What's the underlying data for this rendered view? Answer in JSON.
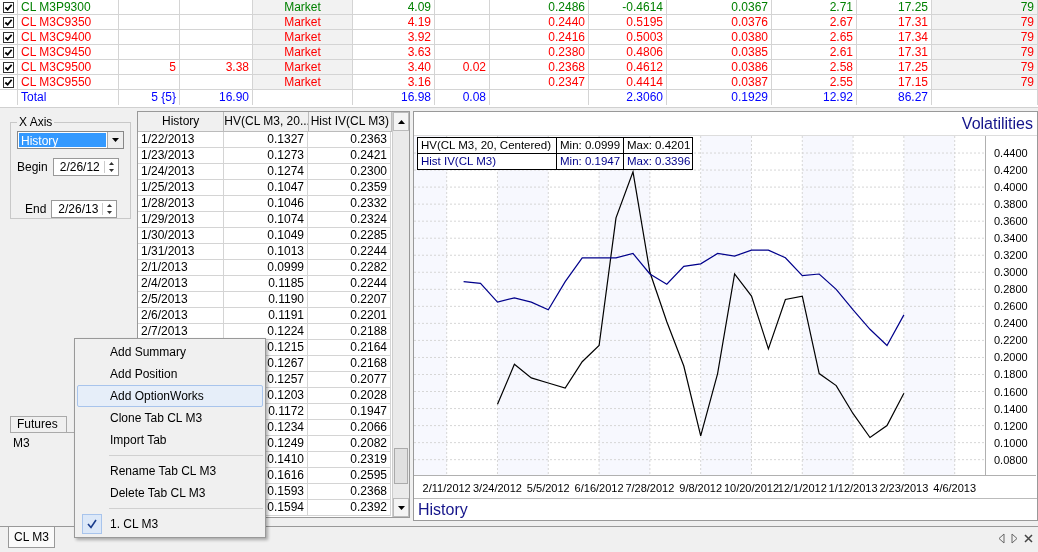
{
  "positions": {
    "rows": [
      {
        "kind": "option",
        "checked": true,
        "color": "#008000",
        "cells": [
          "CL M3P9300",
          null,
          null,
          "Market",
          "4.09",
          null,
          "0.2486",
          "-0.4614",
          "0.0367",
          "2.71",
          "17.25",
          "79"
        ]
      },
      {
        "kind": "option",
        "checked": true,
        "color": "#ff0000",
        "cells": [
          "CL M3C9350",
          null,
          null,
          "Market",
          "4.19",
          null,
          "0.2440",
          "0.5195",
          "0.0376",
          "2.67",
          "17.31",
          "79"
        ]
      },
      {
        "kind": "option",
        "checked": true,
        "color": "#ff0000",
        "cells": [
          "CL M3C9400",
          null,
          null,
          "Market",
          "3.92",
          null,
          "0.2416",
          "0.5003",
          "0.0380",
          "2.65",
          "17.34",
          "79"
        ]
      },
      {
        "kind": "option",
        "checked": true,
        "color": "#ff0000",
        "cells": [
          "CL M3C9450",
          null,
          null,
          "Market",
          "3.63",
          null,
          "0.2380",
          "0.4806",
          "0.0385",
          "2.61",
          "17.31",
          "79"
        ]
      },
      {
        "kind": "option",
        "checked": true,
        "color": "#ff0000",
        "cells": [
          "CL M3C9500",
          "5",
          "3.38",
          "Market",
          "3.40",
          "0.02",
          "0.2368",
          "0.4612",
          "0.0386",
          "2.58",
          "17.25",
          "79"
        ]
      },
      {
        "kind": "option",
        "checked": true,
        "color": "#ff0000",
        "cells": [
          "CL M3C9550",
          null,
          null,
          "Market",
          "3.16",
          null,
          "0.2347",
          "0.4414",
          "0.0387",
          "2.55",
          "17.15",
          "79"
        ]
      },
      {
        "kind": "total",
        "color": "#0000ff",
        "cells": [
          "Total",
          "5 {5}",
          "16.90",
          null,
          "16.98",
          "0.08",
          null,
          "2.3060",
          "0.1929",
          "12.92",
          "86.27",
          null
        ]
      }
    ]
  },
  "x_axis": {
    "title": "X Axis",
    "value": "History",
    "begin_label": "Begin",
    "begin": "2/26/12",
    "end_label": "End",
    "end": "2/26/13"
  },
  "futures": {
    "tab": "Futures",
    "value": "M3"
  },
  "history_table": {
    "columns": [
      "History",
      "HV(CL M3, 20...",
      "Hist IV(CL M3)"
    ],
    "rows": [
      {
        "date": "1/22/2013",
        "hv": "0.1327",
        "iv": "0.2363"
      },
      {
        "date": "1/23/2013",
        "hv": "0.1273",
        "iv": "0.2421"
      },
      {
        "date": "1/24/2013",
        "hv": "0.1274",
        "iv": "0.2300"
      },
      {
        "date": "1/25/2013",
        "hv": "0.1047",
        "iv": "0.2359"
      },
      {
        "date": "1/28/2013",
        "hv": "0.1046",
        "iv": "0.2332"
      },
      {
        "date": "1/29/2013",
        "hv": "0.1074",
        "iv": "0.2324"
      },
      {
        "date": "1/30/2013",
        "hv": "0.1049",
        "iv": "0.2285"
      },
      {
        "date": "1/31/2013",
        "hv": "0.1013",
        "iv": "0.2244"
      },
      {
        "date": "2/1/2013",
        "hv": "0.0999",
        "iv": "0.2282"
      },
      {
        "date": "2/4/2013",
        "hv": "0.1185",
        "iv": "0.2244"
      },
      {
        "date": "2/5/2013",
        "hv": "0.1190",
        "iv": "0.2207"
      },
      {
        "date": "2/6/2013",
        "hv": "0.1191",
        "iv": "0.2201"
      },
      {
        "date": "2/7/2013",
        "hv": "0.1224",
        "iv": "0.2188"
      },
      {
        "hv": "0.1215",
        "iv": "0.2164"
      },
      {
        "hv": "0.1267",
        "iv": "0.2168"
      },
      {
        "hv": "0.1257",
        "iv": "0.2077"
      },
      {
        "hv": "0.1203",
        "iv": "0.2028"
      },
      {
        "hv": "0.1172",
        "iv": "0.1947"
      },
      {
        "hv": "0.1234",
        "iv": "0.2066"
      },
      {
        "hv": "0.1249",
        "iv": "0.2082"
      },
      {
        "hv": "0.1410",
        "iv": "0.2319"
      },
      {
        "hv": "0.1616",
        "iv": "0.2595"
      },
      {
        "hv": "0.1593",
        "iv": "0.2368"
      },
      {
        "hv": "0.1594",
        "iv": "0.2392"
      }
    ]
  },
  "chart": {
    "legend": [
      {
        "min": "Min: 0.0999",
        "max": "Max: 0.4201"
      },
      {
        "min": "Min: 0.1947",
        "max": "Max: 0.3396"
      }
    ],
    "chart_data": {
      "type": "line",
      "title": "Volatilities",
      "xlabel": "History",
      "grid": true,
      "categories": [
        "2/11/2012",
        null,
        null,
        "3/24/2012",
        null,
        null,
        "5/5/2012",
        null,
        null,
        "6/16/2012",
        null,
        null,
        "7/28/2012",
        null,
        null,
        "9/8/2012",
        null,
        null,
        "10/20/2012",
        null,
        null,
        "12/1/2012",
        null,
        null,
        "1/12/2013",
        null,
        null,
        "2/23/2013",
        null,
        null,
        "4/6/2013"
      ],
      "series": [
        {
          "name": "HV(CL M3, 20, Centered)",
          "color": "#000000",
          "values": [
            null,
            null,
            null,
            0.145,
            0.192,
            0.176,
            0.17,
            0.164,
            0.195,
            0.214,
            0.364,
            0.418,
            0.3,
            0.242,
            0.19,
            0.108,
            0.181,
            0.298,
            0.272,
            0.21,
            0.268,
            0.272,
            0.181,
            0.167,
            0.134,
            0.106,
            0.12,
            0.158,
            null,
            null,
            null
          ]
        },
        {
          "name": "Hist IV(CL M3)",
          "color": "#00008b",
          "values": [
            null,
            0.289,
            0.287,
            0.265,
            0.27,
            0.265,
            0.256,
            0.289,
            0.317,
            0.317,
            0.317,
            0.322,
            0.298,
            0.286,
            0.307,
            0.31,
            0.322,
            0.319,
            0.326,
            0.326,
            0.317,
            0.296,
            0.298,
            0.28,
            0.256,
            0.233,
            0.214,
            0.25,
            null,
            null,
            null
          ]
        }
      ],
      "ylim": [
        0.062,
        0.46
      ],
      "yticks": [
        {
          "value": 0.08,
          "label": "0.0800"
        },
        {
          "value": 0.1,
          "label": "0.1000"
        },
        {
          "value": 0.12,
          "label": "0.1200"
        },
        {
          "value": 0.14,
          "label": "0.1400"
        },
        {
          "value": 0.16,
          "label": "0.1600"
        },
        {
          "value": 0.18,
          "label": "0.1800"
        },
        {
          "value": 0.2,
          "label": "0.2000"
        },
        {
          "value": 0.22,
          "label": "0.2200"
        },
        {
          "value": 0.24,
          "label": "0.2400"
        },
        {
          "value": 0.26,
          "label": "0.2600"
        },
        {
          "value": 0.28,
          "label": "0.2800"
        },
        {
          "value": 0.3,
          "label": "0.3000"
        },
        {
          "value": 0.32,
          "label": "0.3200"
        },
        {
          "value": 0.34,
          "label": "0.3400"
        },
        {
          "value": 0.36,
          "label": "0.3600"
        },
        {
          "value": 0.38,
          "label": "0.3800"
        },
        {
          "value": 0.4,
          "label": "0.4000"
        },
        {
          "value": 0.42,
          "label": "0.4200"
        },
        {
          "value": 0.44,
          "label": "0.4400"
        }
      ]
    }
  },
  "context_menu": {
    "items": [
      {
        "kind": "item",
        "label": "Add Summary",
        "highlighted": false,
        "checked": false
      },
      {
        "kind": "item",
        "label": "Add Position",
        "highlighted": false,
        "checked": false
      },
      {
        "kind": "item",
        "label": "Add OptionWorks",
        "highlighted": true,
        "checked": false
      },
      {
        "kind": "item",
        "label": "Clone Tab CL M3",
        "highlighted": false,
        "checked": false
      },
      {
        "kind": "item",
        "label": "Import Tab",
        "highlighted": false,
        "checked": false
      },
      {
        "kind": "separator"
      },
      {
        "kind": "item",
        "label": "Rename Tab CL M3",
        "highlighted": false,
        "checked": false
      },
      {
        "kind": "item",
        "label": "Delete Tab CL M3",
        "highlighted": false,
        "checked": false
      },
      {
        "kind": "separator"
      },
      {
        "kind": "item",
        "label": "1. CL M3",
        "highlighted": false,
        "checked": true
      }
    ]
  },
  "tabs": [
    {
      "label": "CL M3",
      "selected": true
    }
  ]
}
